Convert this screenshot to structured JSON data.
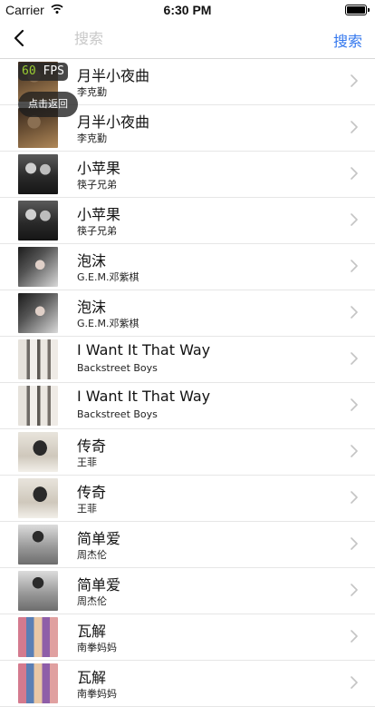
{
  "status_bar": {
    "carrier": "Carrier",
    "time": "6:30 PM"
  },
  "nav": {
    "search_placeholder": "搜索",
    "search_button": "搜索"
  },
  "overlay": {
    "fps_value": "60",
    "fps_unit": " FPS",
    "toast": "点击返回"
  },
  "songs": [
    {
      "title": "月半小夜曲",
      "artist": "李克勤"
    },
    {
      "title": "月半小夜曲",
      "artist": "李克勤"
    },
    {
      "title": "小苹果",
      "artist": "筷子兄弟"
    },
    {
      "title": "小苹果",
      "artist": "筷子兄弟"
    },
    {
      "title": "泡沫",
      "artist": "G.E.M.邓紫棋"
    },
    {
      "title": "泡沫",
      "artist": "G.E.M.邓紫棋"
    },
    {
      "title": "I Want It That Way",
      "artist": "Backstreet Boys"
    },
    {
      "title": "I Want It That Way",
      "artist": "Backstreet Boys"
    },
    {
      "title": "传奇",
      "artist": "王菲"
    },
    {
      "title": "传奇",
      "artist": "王菲"
    },
    {
      "title": "简单爱",
      "artist": "周杰伦"
    },
    {
      "title": "简单爱",
      "artist": "周杰伦"
    },
    {
      "title": "瓦解",
      "artist": "南拳妈妈"
    },
    {
      "title": "瓦解",
      "artist": "南拳妈妈"
    }
  ],
  "colors": {
    "accent": "#3377ee",
    "fps_value": "#9acd32"
  }
}
